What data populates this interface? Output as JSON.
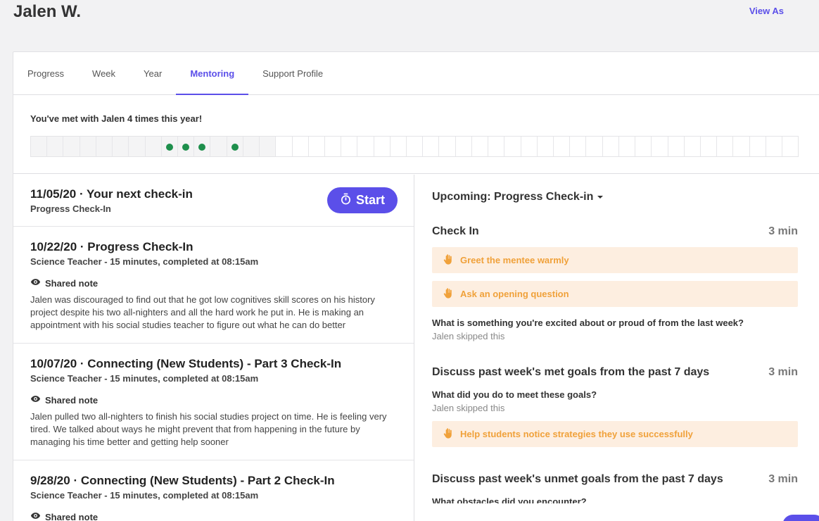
{
  "student_name": "Jalen W.",
  "view_as_label": "View As",
  "tabs": [
    {
      "label": "Progress",
      "active": false
    },
    {
      "label": "Week",
      "active": false
    },
    {
      "label": "Year",
      "active": false
    },
    {
      "label": "Mentoring",
      "active": true
    },
    {
      "label": "Support Profile",
      "active": false
    }
  ],
  "met_summary": "You've met with Jalen 4 times this year!",
  "weeks_total": 47,
  "weeks_past": 15,
  "met_weeks": [
    8,
    9,
    10,
    12
  ],
  "next_checkin": {
    "title": "11/05/20 · Your next check-in",
    "subtitle": "Progress Check-In",
    "start_label": "Start"
  },
  "checkins": [
    {
      "title": "10/22/20 · Progress Check-In",
      "subtitle": "Science Teacher - 15 minutes, completed at 08:15am",
      "shared_label": "Shared note",
      "note": "Jalen was discouraged to find out that he got low cognitives skill scores on his history project despite his two all-nighters and all the hard work he put in. He is making an appointment with his social studies teacher to figure out what he can do better"
    },
    {
      "title": "10/07/20 · Connecting (New Students) - Part 3 Check-In",
      "subtitle": "Science Teacher - 15 minutes, completed at 08:15am",
      "shared_label": "Shared note",
      "note": "Jalen pulled two all-nighters to finish his social studies project on time. He is feeling very tired. We talked about ways he might prevent that from happening in the future by managing his time better and getting help sooner"
    },
    {
      "title": "9/28/20 · Connecting (New Students) - Part 2 Check-In",
      "subtitle": "Science Teacher - 15 minutes, completed at 08:15am",
      "shared_label": "Shared note",
      "note": ""
    }
  ],
  "upcoming_label": "Upcoming: Progress Check-in",
  "sections": [
    {
      "title": "Check In",
      "duration": "3 min",
      "tips": [
        "Greet the mentee warmly",
        "Ask an opening question"
      ],
      "question": "What is something you're excited about or proud of from the last week?",
      "status": "Jalen skipped this"
    },
    {
      "title": "Discuss past week's met goals from the past 7 days",
      "duration": "3 min",
      "question": "What did you do to meet these goals?",
      "status": "Jalen skipped this",
      "tips": [
        "Help students notice strategies they use successfully"
      ]
    },
    {
      "title": "Discuss past week's unmet goals from the past 7 days",
      "duration": "3 min",
      "question": "What obstacles did you encounter?"
    }
  ],
  "colors": {
    "accent": "#5b4fe9",
    "met_dot": "#1e8f4c",
    "tip_bg": "#fdeee0",
    "tip_text": "#f0a13a"
  }
}
